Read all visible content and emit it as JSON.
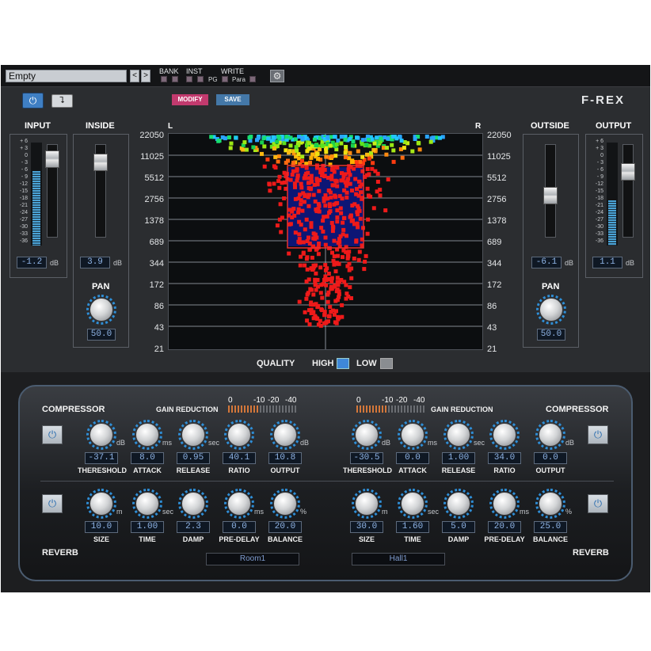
{
  "topbar": {
    "preset": "Empty",
    "prev": "<",
    "next": ">",
    "bank": "BANK",
    "inst": "INST",
    "write": "WRITE",
    "pg": "PG",
    "para": "Para"
  },
  "header": {
    "modify": "MODIFY",
    "save": "SAVE",
    "brand": "F-REX"
  },
  "input": {
    "title": "INPUT",
    "value": "-1.2",
    "unit": "dB",
    "level": 0.75
  },
  "inside": {
    "title": "INSIDE",
    "value": "3.9",
    "unit": "dB",
    "pan_label": "PAN",
    "pan_value": "50.0"
  },
  "outside": {
    "title": "OUTSIDE",
    "value": "-6.1",
    "unit": "dB",
    "pan_label": "PAN",
    "pan_value": "50.0"
  },
  "output": {
    "title": "OUTPUT",
    "value": "1.1",
    "unit": "dB",
    "level": 0.45
  },
  "meter_scale": [
    "+ 6",
    "+ 3",
    "0",
    "- 3",
    "- 6",
    "- 9",
    "-12",
    "-15",
    "-18",
    "-21",
    "-24",
    "-27",
    "-30",
    "-33",
    "-36"
  ],
  "display": {
    "left": "L",
    "right": "R",
    "freqs": [
      "22050",
      "11025",
      "5512",
      "2756",
      "1378",
      "689",
      "344",
      "172",
      "86",
      "43",
      "21"
    ]
  },
  "quality": {
    "label": "QUALITY",
    "high": "HIGH",
    "low": "LOW"
  },
  "fx_left": {
    "compressor": "COMPRESSOR",
    "gain_reduction": "GAIN REDUCTION",
    "gr_scale": [
      "0",
      "-10",
      "-20",
      "-40"
    ],
    "comp_knobs": [
      {
        "label": "THERESHOLD",
        "value": "-37.1",
        "unit": "dB"
      },
      {
        "label": "ATTACK",
        "value": "8.0",
        "unit": "ms"
      },
      {
        "label": "RELEASE",
        "value": "0.95",
        "unit": "sec"
      },
      {
        "label": "RATIO",
        "value": "40.1",
        "unit": ""
      },
      {
        "label": "OUTPUT",
        "value": "10.8",
        "unit": "dB"
      }
    ],
    "reverb": "REVERB",
    "rev_knobs": [
      {
        "label": "SIZE",
        "value": "10.0",
        "unit": "m"
      },
      {
        "label": "TIME",
        "value": "1.00",
        "unit": "sec"
      },
      {
        "label": "DAMP",
        "value": "2.3",
        "unit": ""
      },
      {
        "label": "PRE-DELAY",
        "value": "0.0",
        "unit": "ms"
      },
      {
        "label": "BALANCE",
        "value": "20.0",
        "unit": "%"
      }
    ],
    "preset": "Room1"
  },
  "fx_right": {
    "compressor": "COMPRESSOR",
    "gain_reduction": "GAIN REDUCTION",
    "gr_scale": [
      "0",
      "-10",
      "-20",
      "-40"
    ],
    "comp_knobs": [
      {
        "label": "THERESHOLD",
        "value": "-30.5",
        "unit": "dB"
      },
      {
        "label": "ATTACK",
        "value": "0.0",
        "unit": "ms"
      },
      {
        "label": "RELEASE",
        "value": "1.00",
        "unit": "sec"
      },
      {
        "label": "RATIO",
        "value": "34.0",
        "unit": ""
      },
      {
        "label": "OUTPUT",
        "value": "0.0",
        "unit": "dB"
      }
    ],
    "reverb": "REVERB",
    "rev_knobs": [
      {
        "label": "SIZE",
        "value": "30.0",
        "unit": "m"
      },
      {
        "label": "TIME",
        "value": "1.60",
        "unit": "sec"
      },
      {
        "label": "DAMP",
        "value": "5.0",
        "unit": ""
      },
      {
        "label": "PRE-DELAY",
        "value": "20.0",
        "unit": "ms"
      },
      {
        "label": "BALANCE",
        "value": "25.0",
        "unit": "%"
      }
    ],
    "preset": "Hall1"
  },
  "colors": {
    "accent": "#3f7fc4",
    "modify": "#c23a6e",
    "save": "#4478a8",
    "knob_ring": "#2f8fd8",
    "meter": "#4aa3d6",
    "selection": "#e83030",
    "gr_active": "#d4773a"
  }
}
